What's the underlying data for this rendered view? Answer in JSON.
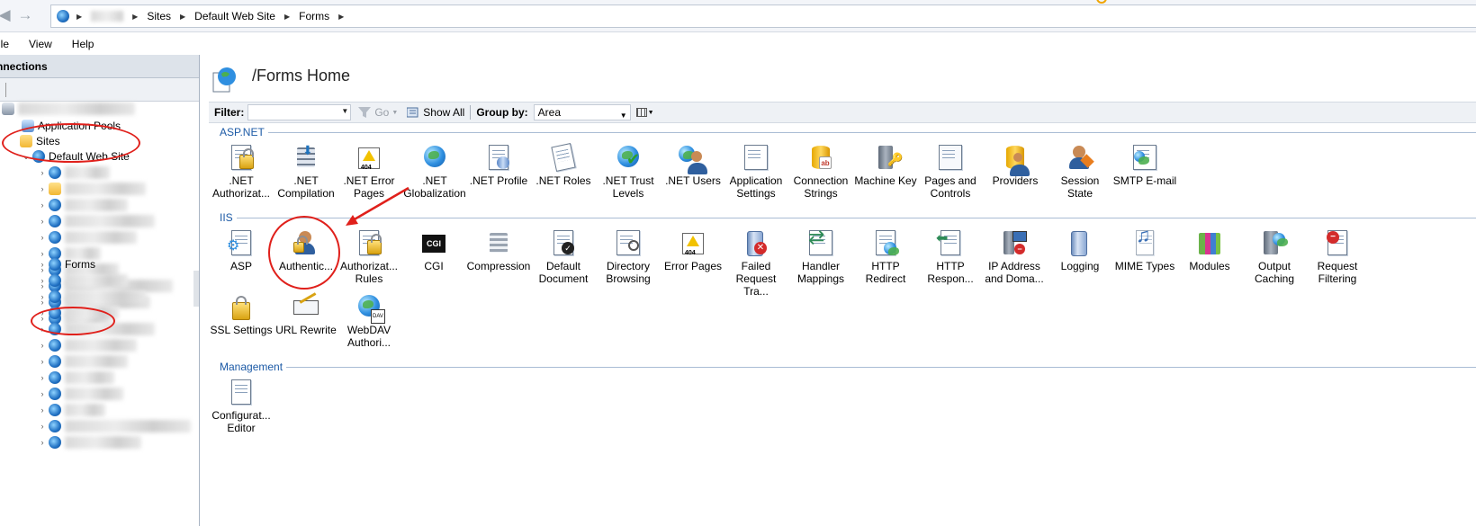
{
  "address": {
    "crumbs": [
      "Sites",
      "Default Web Site",
      "Forms"
    ]
  },
  "menu": {
    "items": [
      "File",
      "View",
      "Help"
    ]
  },
  "connections": {
    "header": "Connections",
    "tree": {
      "application_pools": "Application Pools",
      "sites": "Sites",
      "default_web_site": "Default Web Site",
      "forms": "Forms"
    }
  },
  "content": {
    "title": "/Forms Home",
    "filter": {
      "label": "Filter:",
      "go": "Go",
      "show_all": "Show All",
      "group_by_label": "Group by:",
      "group_by_value": "Area"
    },
    "groups": {
      "aspnet": {
        "title": "ASP.NET",
        "items": [
          {
            "label": ".NET Authorizat...",
            "icon": "net-authorization-icon"
          },
          {
            "label": ".NET Compilation",
            "icon": "net-compilation-icon"
          },
          {
            "label": ".NET Error Pages",
            "icon": "net-error-pages-icon"
          },
          {
            "label": ".NET Globalization",
            "icon": "net-globalization-icon"
          },
          {
            "label": ".NET Profile",
            "icon": "net-profile-icon"
          },
          {
            "label": ".NET Roles",
            "icon": "net-roles-icon"
          },
          {
            "label": ".NET Trust Levels",
            "icon": "net-trust-levels-icon"
          },
          {
            "label": ".NET Users",
            "icon": "net-users-icon"
          },
          {
            "label": "Application Settings",
            "icon": "application-settings-icon"
          },
          {
            "label": "Connection Strings",
            "icon": "connection-strings-icon"
          },
          {
            "label": "Machine Key",
            "icon": "machine-key-icon"
          },
          {
            "label": "Pages and Controls",
            "icon": "pages-and-controls-icon"
          },
          {
            "label": "Providers",
            "icon": "providers-icon"
          },
          {
            "label": "Session State",
            "icon": "session-state-icon"
          },
          {
            "label": "SMTP E-mail",
            "icon": "smtp-email-icon"
          }
        ]
      },
      "iis": {
        "title": "IIS",
        "items": [
          {
            "label": "ASP",
            "icon": "asp-icon"
          },
          {
            "label": "Authentic...",
            "icon": "authentication-icon"
          },
          {
            "label": "Authorizat... Rules",
            "icon": "authorization-rules-icon"
          },
          {
            "label": "CGI",
            "icon": "cgi-icon"
          },
          {
            "label": "Compression",
            "icon": "compression-icon"
          },
          {
            "label": "Default Document",
            "icon": "default-document-icon"
          },
          {
            "label": "Directory Browsing",
            "icon": "directory-browsing-icon"
          },
          {
            "label": "Error Pages",
            "icon": "error-pages-icon"
          },
          {
            "label": "Failed Request Tra...",
            "icon": "failed-request-tracing-icon"
          },
          {
            "label": "Handler Mappings",
            "icon": "handler-mappings-icon"
          },
          {
            "label": "HTTP Redirect",
            "icon": "http-redirect-icon"
          },
          {
            "label": "HTTP Respon...",
            "icon": "http-response-headers-icon"
          },
          {
            "label": "IP Address and Doma...",
            "icon": "ip-address-domain-icon"
          },
          {
            "label": "Logging",
            "icon": "logging-icon"
          },
          {
            "label": "MIME Types",
            "icon": "mime-types-icon"
          },
          {
            "label": "Modules",
            "icon": "modules-icon"
          },
          {
            "label": "Output Caching",
            "icon": "output-caching-icon"
          },
          {
            "label": "Request Filtering",
            "icon": "request-filtering-icon"
          },
          {
            "label": "SSL Settings",
            "icon": "ssl-settings-icon"
          },
          {
            "label": "URL Rewrite",
            "icon": "url-rewrite-icon"
          },
          {
            "label": "WebDAV Authori...",
            "icon": "webdav-authoring-icon"
          }
        ]
      },
      "management": {
        "title": "Management",
        "items": [
          {
            "label": "Configurat... Editor",
            "icon": "configuration-editor-icon"
          }
        ]
      }
    }
  },
  "colors": {
    "annotation_red": "#e0201b",
    "group_title": "#1c5aa6"
  }
}
